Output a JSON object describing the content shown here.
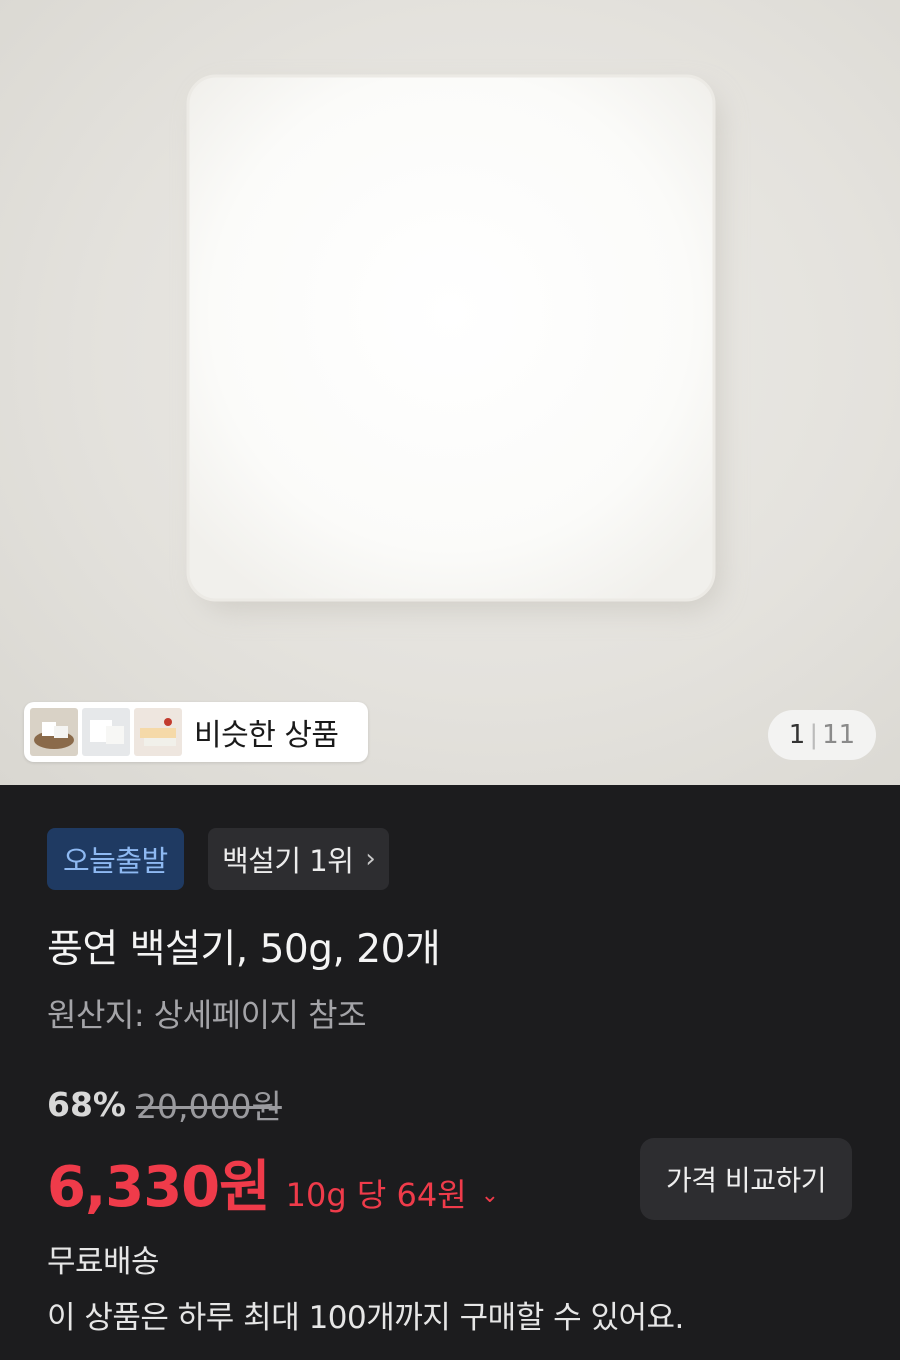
{
  "gallery": {
    "similar_label": "비슷한 상품",
    "page_current": "1",
    "page_separator": "|",
    "page_total": "11"
  },
  "badges": {
    "today_label": "오늘출발",
    "rank_label": "백설기 1위",
    "rank_chevron": "›"
  },
  "product": {
    "title": "풍연 백설기, 50g, 20개",
    "origin": "원산지: 상세페이지 참조"
  },
  "pricing": {
    "discount_percent": "68%",
    "original_price": "20,000원",
    "sale_price": "6,330원",
    "unit_price": "10g 당 64원",
    "unit_chevron": "⌄",
    "compare_button": "가격 비교하기"
  },
  "delivery": {
    "shipping": "무료배송",
    "purchase_limit": "이 상품은 하루 최대 100개까지 구매할 수 있어요."
  },
  "colors": {
    "accent_red": "#ef3b4a",
    "today_badge_bg": "#1f3a62",
    "today_badge_text": "#8eb9f2",
    "background": "#1c1c1e"
  }
}
